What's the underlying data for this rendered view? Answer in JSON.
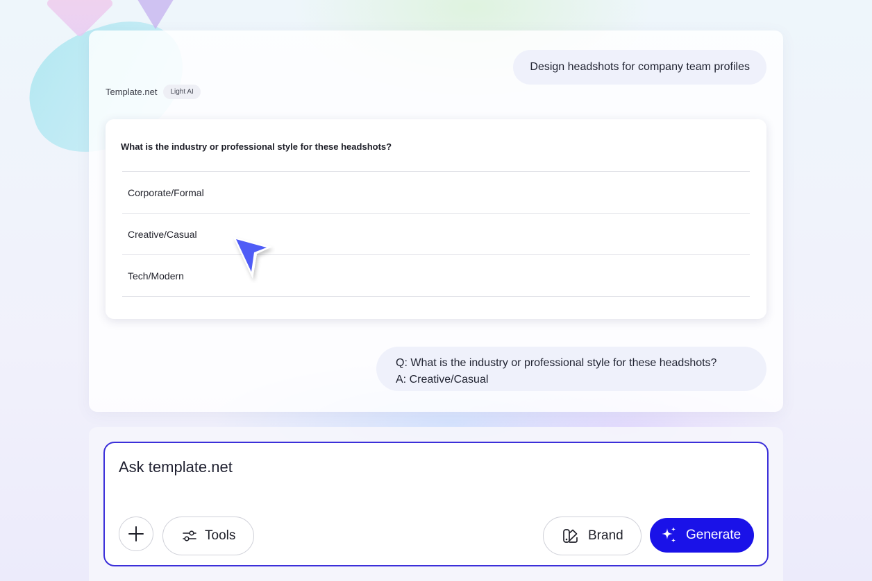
{
  "chat": {
    "user_prompt": "Design headshots for company team profiles",
    "source": {
      "name": "Template.net",
      "badge": "Light AI"
    },
    "question_card": {
      "question": "What is the industry or professional style for these headshots?",
      "options": [
        "Corporate/Formal",
        "Creative/Casual",
        "Tech/Modern"
      ]
    },
    "answer": {
      "question_line": "Q: What is the industry or professional style for these headshots?",
      "answer_line": "A: Creative/Casual"
    }
  },
  "composer": {
    "placeholder": "Ask template.net",
    "add_icon": "plus-icon",
    "tools_label": "Tools",
    "tools_icon": "sliders-icon",
    "brand_label": "Brand",
    "brand_icon": "palette-icon",
    "generate_label": "Generate",
    "generate_icon": "sparkles-icon"
  },
  "colors": {
    "accent": "#1a12e8",
    "composer_border": "#3b2fd9",
    "cursor": "#4f5cf6"
  }
}
